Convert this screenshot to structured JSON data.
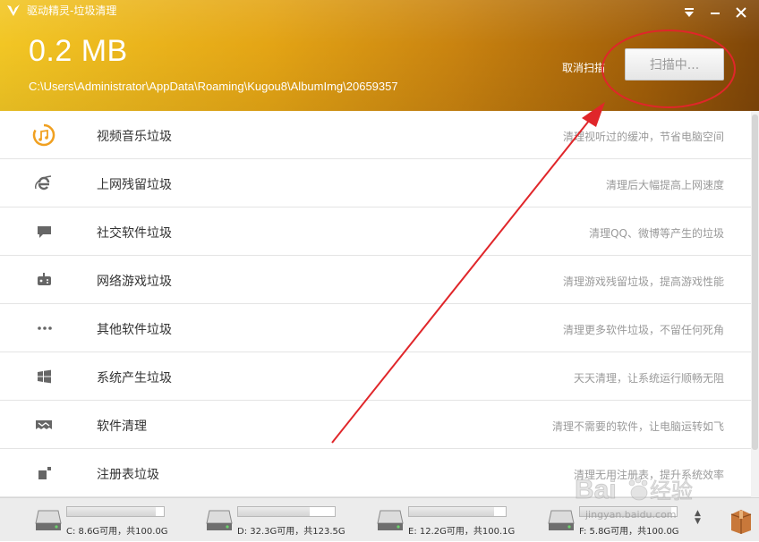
{
  "window": {
    "title": "驱动精灵-垃圾清理",
    "minimize_icon": "dropdown-menu-icon",
    "close_icon": "close-icon"
  },
  "header": {
    "size": "0.2 MB",
    "path": "C:\\Users\\Administrator\\AppData\\Roaming\\Kugou8\\AlbumImg\\20659357",
    "cancel_label": "取消扫描",
    "scan_button_label": "扫描中..."
  },
  "categories": [
    {
      "icon": "music-icon",
      "title": "视频音乐垃圾",
      "desc": "清理视听过的缓冲，节省电脑空间"
    },
    {
      "icon": "ie-icon",
      "title": "上网残留垃圾",
      "desc": "清理后大幅提高上网速度"
    },
    {
      "icon": "chat-icon",
      "title": "社交软件垃圾",
      "desc": "清理QQ、微博等产生的垃圾"
    },
    {
      "icon": "gamepad-icon",
      "title": "网络游戏垃圾",
      "desc": "清理游戏残留垃圾，提高游戏性能"
    },
    {
      "icon": "more-icon",
      "title": "其他软件垃圾",
      "desc": "清理更多软件垃圾，不留任何死角"
    },
    {
      "icon": "windows-icon",
      "title": "系统产生垃圾",
      "desc": "天天清理，让系统运行顺畅无阻"
    },
    {
      "icon": "software-clean-icon",
      "title": "软件清理",
      "desc": "清理不需要的软件，让电脑运转如飞"
    },
    {
      "icon": "registry-icon",
      "title": "注册表垃圾",
      "desc": "清理无用注册表，提升系统效率"
    }
  ],
  "drives": [
    {
      "label": "C: 8.6G可用，共100.0G",
      "used_fraction": 0.914
    },
    {
      "label": "D: 32.3G可用，共123.5G",
      "used_fraction": 0.738
    },
    {
      "label": "E: 12.2G可用，共100.1G",
      "used_fraction": 0.878
    },
    {
      "label": "F: 5.8G可用，共100.0G",
      "used_fraction": 0.942
    }
  ],
  "watermark": {
    "logo_text": "Bai经验",
    "url": "jingyan.baidu.com"
  },
  "colors": {
    "header_start": "#f2c624",
    "header_end": "#7e4508",
    "annotation_red": "#e0262a"
  }
}
